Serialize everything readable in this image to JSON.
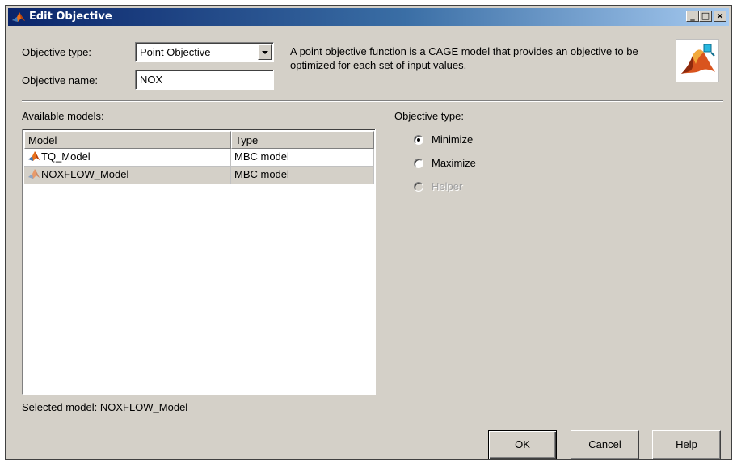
{
  "window": {
    "title": "Edit Objective",
    "controls": {
      "minimize": "_",
      "maximize": "□",
      "close": "×"
    }
  },
  "header": {
    "objective_type_label": "Objective type:",
    "objective_type_value": "Point Objective",
    "objective_name_label": "Objective name:",
    "objective_name_value": "NOX",
    "description": "A point objective function is a CAGE model that provides an objective to be optimized for each set of input values.",
    "logo_icon": "matlab-membrane-icon"
  },
  "models": {
    "label": "Available models:",
    "columns": [
      "Model",
      "Type"
    ],
    "rows": [
      {
        "model": "TQ_Model",
        "type": "MBC model",
        "icon": "model-icon"
      },
      {
        "model": "NOXFLOW_Model",
        "type": "MBC model",
        "icon": "model-icon"
      }
    ],
    "selected_text": "Selected model: NOXFLOW_Model"
  },
  "objective_type": {
    "label": "Objective type:",
    "options": [
      {
        "label": "Minimize",
        "checked": true,
        "disabled": false
      },
      {
        "label": "Maximize",
        "checked": false,
        "disabled": false
      },
      {
        "label": "Helper",
        "checked": false,
        "disabled": true
      }
    ]
  },
  "buttons": {
    "ok": "OK",
    "cancel": "Cancel",
    "help": "Help"
  },
  "colors": {
    "titlebar_start": "#0a246a",
    "titlebar_end": "#a6caf0",
    "dialog_bg": "#d4d0c8"
  }
}
